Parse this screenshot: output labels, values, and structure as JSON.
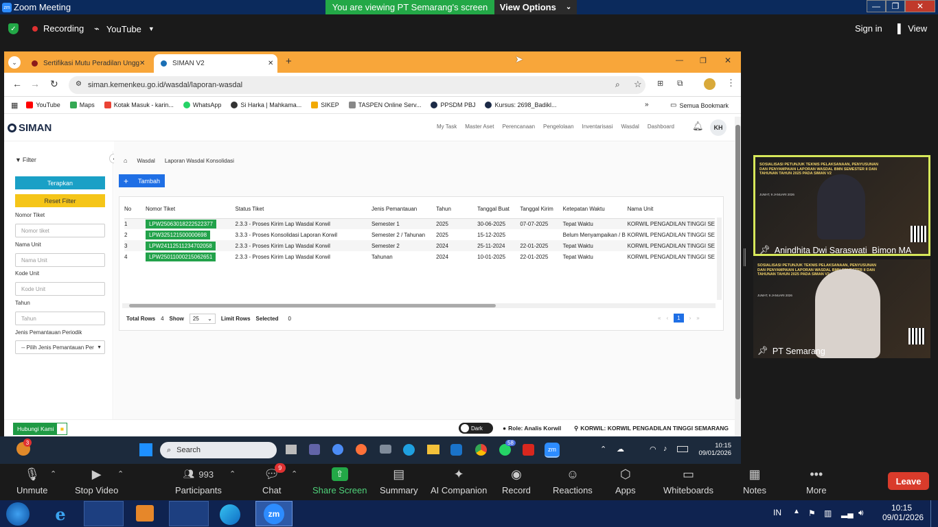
{
  "zoom": {
    "title": "Zoom Meeting",
    "viewing_banner": "You are viewing PT Semarang's screen",
    "view_options": "View Options",
    "recording": "Recording",
    "stream": "YouTube",
    "sign_in": "Sign in",
    "view": "View",
    "controls": [
      {
        "label": "Unmute",
        "icon": "mic-off-icon"
      },
      {
        "label": "Stop Video",
        "icon": "video-icon"
      },
      {
        "label": "Participants",
        "icon": "participants-icon",
        "count": "993"
      },
      {
        "label": "Chat",
        "icon": "chat-icon",
        "badge": "9"
      },
      {
        "label": "Share Screen",
        "icon": "share-screen-icon"
      },
      {
        "label": "Summary",
        "icon": "summary-icon"
      },
      {
        "label": "AI Companion",
        "icon": "ai-companion-icon"
      },
      {
        "label": "Record",
        "icon": "record-icon"
      },
      {
        "label": "Reactions",
        "icon": "reactions-icon"
      },
      {
        "label": "Apps",
        "icon": "apps-icon"
      },
      {
        "label": "Whiteboards",
        "icon": "whiteboard-icon"
      },
      {
        "label": "Notes",
        "icon": "notes-icon"
      },
      {
        "label": "More",
        "icon": "more-icon"
      }
    ],
    "leave": "Leave",
    "participants": [
      {
        "name": "Anindhita Dwi Saraswati_Bimon MA"
      },
      {
        "name": "PT Semarang"
      }
    ],
    "slide_text": "SOSIALISASI PETUNJUK TEKNIS PELAKSANAAN, PENYUSUNAN DAN PENYAMPAIAN LAPORAN WASDAL BMN SEMESTER II DAN TAHUNAN TAHUN 2025 PADA SIMAN V2",
    "slide_date": "JUMAT, 9 JANUARI 2026"
  },
  "browser": {
    "tabs": [
      {
        "title": "Sertifikasi Mutu Peradilan Ungg"
      },
      {
        "title": "SIMAN V2"
      }
    ],
    "url": "siman.kemenkeu.go.id/wasdal/laporan-wasdal",
    "bookmarks": [
      {
        "label": "YouTube",
        "color": "#ff0000"
      },
      {
        "label": "Maps",
        "color": "#34a853"
      },
      {
        "label": "Kotak Masuk - karin...",
        "color": "#ea4335"
      },
      {
        "label": "WhatsApp",
        "color": "#25d366"
      },
      {
        "label": "Si Harka | Mahkama...",
        "color": "#333333"
      },
      {
        "label": "SIKEP",
        "color": "#f2a900"
      },
      {
        "label": "TASPEN Online Serv...",
        "color": "#888888"
      },
      {
        "label": "PPSDM PBJ",
        "color": "#1b2a46"
      },
      {
        "label": "Kursus: 2698_Badikl...",
        "color": "#1b2a46"
      }
    ],
    "all_bookmarks": "Semua Bookmark"
  },
  "app": {
    "logo": "SIMAN",
    "nav": [
      "My Task",
      "Master Aset",
      "Perencanaan",
      "Pengelolaan",
      "Inventarisasi",
      "Wasdal",
      "Dashboard"
    ],
    "avatar": "KH",
    "filter_title": "Filter",
    "apply": "Terapkan",
    "reset": "Reset Filter",
    "fields": [
      {
        "label": "Nomor Tiket",
        "placeholder": "Nomor tiket"
      },
      {
        "label": "Nama Unit",
        "placeholder": "Nama Unit"
      },
      {
        "label": "Kode Unit",
        "placeholder": "Kode Unit"
      },
      {
        "label": "Tahun",
        "placeholder": "Tahun"
      }
    ],
    "period_label": "Jenis Pemantauan Periodik",
    "period_value": "-- Pilih Jenis Pemantauan Per",
    "breadcrumb": [
      "Wasdal",
      "Laporan Wasdal Konsolidasi"
    ],
    "add_button": "Tambah",
    "columns": [
      "No",
      "Nomor Tiket",
      "Status Tiket",
      "Jenis Pemantauan",
      "Tahun",
      "Tanggal Buat",
      "Tanggal Kirim",
      "Ketepatan Waktu",
      "Nama Unit"
    ],
    "rows": [
      {
        "no": "1",
        "tiket": "LPW25063018222522377",
        "status": "2.3.3 - Proses Kirim Lap Wasdal Korwil",
        "jenis": "Semester 1",
        "tahun": "2025",
        "buat": "30-06-2025",
        "kirim": "07-07-2025",
        "tepat": "Tepat Waktu",
        "unit": "KORWIL PENGADILAN TINGGI SE"
      },
      {
        "no": "2",
        "tiket": "LPW325121500000698",
        "status": "3.3.3 - Proses Konsolidasi Laporan Korwil",
        "jenis": "Semester 2 / Tahunan",
        "tahun": "2025",
        "buat": "15-12-2025",
        "kirim": "",
        "tepat": "Belum Menyampaikan / B",
        "unit": "KORWIL PENGADILAN TINGGI SE"
      },
      {
        "no": "3",
        "tiket": "LPW24112511234702058",
        "status": "2.3.3 - Proses Kirim Lap Wasdal Korwil",
        "jenis": "Semester 2",
        "tahun": "2024",
        "buat": "25-11-2024",
        "kirim": "22-01-2025",
        "tepat": "Tepat Waktu",
        "unit": "KORWIL PENGADILAN TINGGI SE"
      },
      {
        "no": "4",
        "tiket": "LPW25011000215062651",
        "status": "2.3.3 - Proses Kirim Lap Wasdal Korwil",
        "jenis": "Tahunan",
        "tahun": "2024",
        "buat": "10-01-2025",
        "kirim": "22-01-2025",
        "tepat": "Tepat Waktu",
        "unit": "KORWIL PENGADILAN TINGGI SE"
      }
    ],
    "total_rows_label": "Total Rows",
    "total_rows": "4",
    "show_label": "Show",
    "show_value": "25",
    "limit_rows": "Limit Rows",
    "selected_label": "Selected",
    "selected_value": "0",
    "page": "1",
    "contact": "Hubungi Kami",
    "dark": "Dark",
    "role": "Role: Analis Korwil",
    "korwil": "KORWIL: KORWIL PENGADILAN TINGGI SEMARANG"
  },
  "win_taskbar": {
    "weather_badge": "3",
    "search": "Search",
    "time": "10:15",
    "date": "09/01/2026",
    "whatsapp_badge": "58"
  },
  "os_taskbar": {
    "lang": "IN",
    "time": "10:15",
    "date": "09/01/2026"
  }
}
